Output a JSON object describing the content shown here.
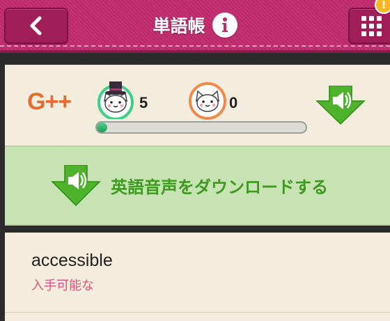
{
  "header": {
    "title": "単語帳",
    "back_icon": "chevron-left-icon",
    "info_icon": "info-icon",
    "menu_icon": "grid-menu-icon",
    "notification_badge": "!",
    "colors": {
      "header_bg": "#c22a6e",
      "button_bg": "#a01e58"
    }
  },
  "status": {
    "grade_label": "G++",
    "cat_top_hat_count": "5",
    "cat_orange_count": "0",
    "progress_fraction": 0.05
  },
  "download": {
    "label": "英語音声をダウンロードする",
    "icon": "speaker-download-icon",
    "colors": {
      "bar_bg": "#c7e3b3",
      "text": "#3d9a1e",
      "arrow": "#4cb32a"
    }
  },
  "words": [
    {
      "word": "accessible",
      "meaning": "入手可能な"
    }
  ]
}
